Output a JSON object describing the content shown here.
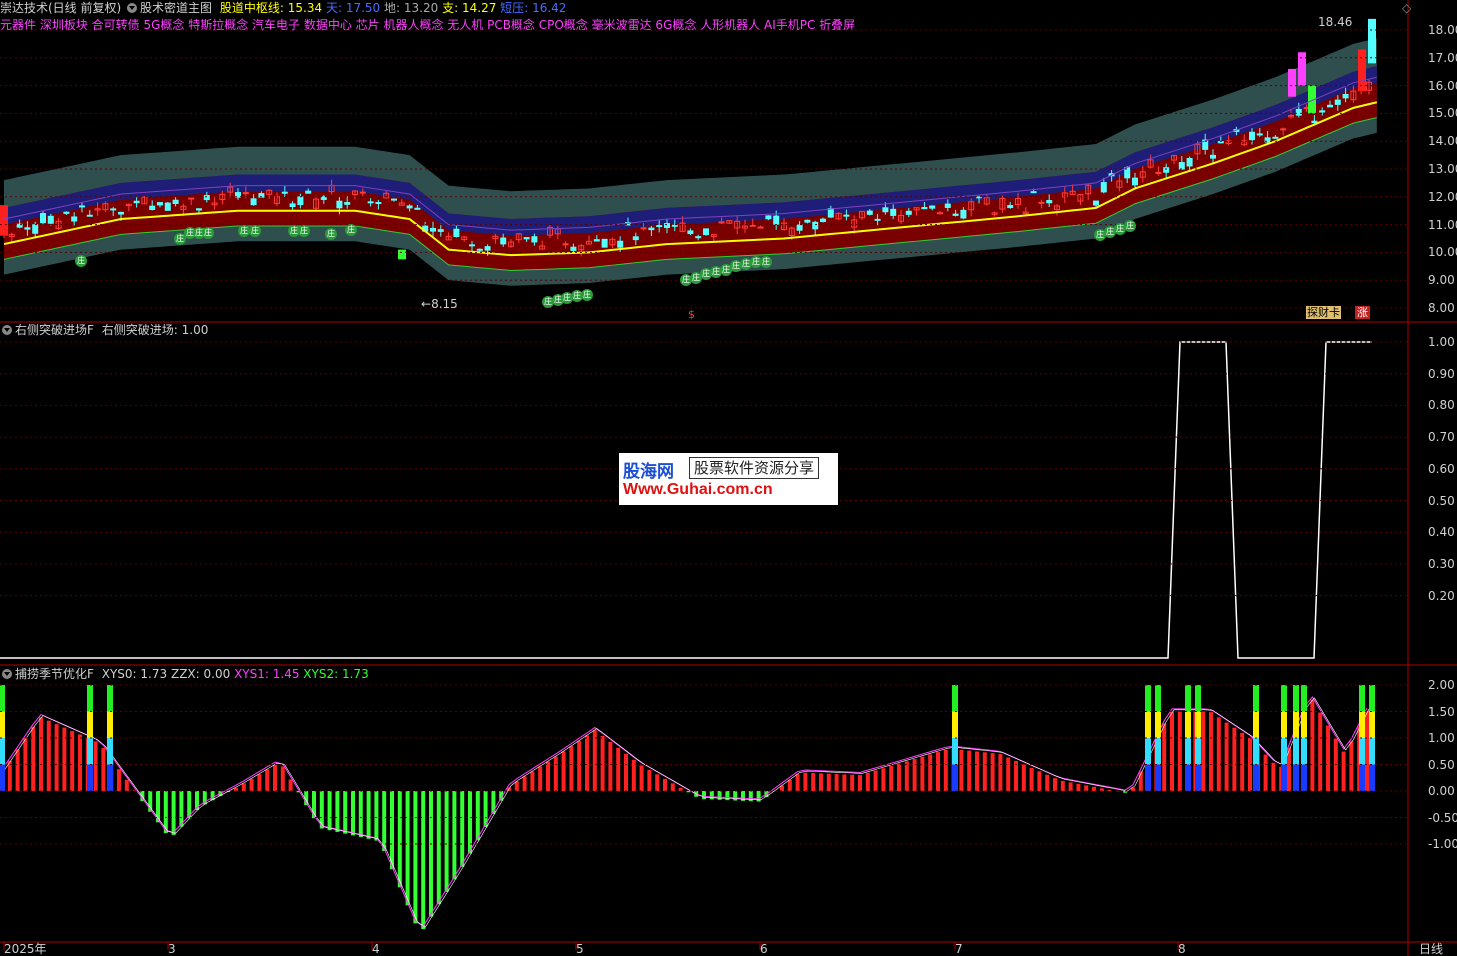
{
  "header": {
    "app_title": "崇达技术(日线 前复权)",
    "indicator_name": "股术密道主图",
    "center_label": "股道中枢线",
    "center_value": "15.34",
    "tian_label": "天",
    "tian_value": "17.50",
    "di_label": "地",
    "di_value": "13.20",
    "zhi_label": "支",
    "zhi_value": "14.27",
    "ya_label": "短压",
    "ya_value": "16.42"
  },
  "concepts_text": "元器件 深圳板块 合可转债 5G概念 特斯拉概念 汽车电子 数据中心 芯片 机器人概念 无人机 PCB概念 CPO概念 毫米波雷达 6G概念 人形机器人 AI手机PC 折叠屏",
  "main_chart": {
    "high_label": "18.46",
    "low_label": "8.15",
    "zhuang_label": "庄",
    "dollar_label": "$",
    "tag_buy": "探财卡",
    "tag_up": "涨",
    "y_ticks": [
      "18.00",
      "17.00",
      "16.00",
      "15.00",
      "14.00",
      "13.00",
      "12.00",
      "11.00",
      "10.00",
      "9.00",
      "8.00"
    ]
  },
  "panel2": {
    "name": "右侧突破进场F",
    "value_label": "右侧突破进场",
    "value": "1.00",
    "y_ticks": [
      "1.00",
      "0.90",
      "0.80",
      "0.70",
      "0.60",
      "0.50",
      "0.40",
      "0.30",
      "0.20"
    ]
  },
  "panel3": {
    "name": "捕捞季节优化F",
    "v1_label": "XYS0",
    "v1": "1.73",
    "v2_label": "ZZX",
    "v2": "0.00",
    "v3_label": "XYS1",
    "v3": "1.45",
    "v4_label": "XYS2",
    "v4": "1.73",
    "y_ticks": [
      "2.00",
      "1.50",
      "1.00",
      "0.50",
      "0.00",
      "-0.50",
      "-1.00"
    ]
  },
  "x_axis": {
    "labels": [
      "2025年",
      "3",
      "4",
      "5",
      "6",
      "7",
      "8"
    ],
    "period": "日线"
  },
  "watermark": {
    "brand": "股海网",
    "slogan": "股票软件资源分享",
    "url": "Www.Guhai.com.cn"
  },
  "colors": {
    "up": "#ff3b3b",
    "down": "#54ffff",
    "band_outer": "#2f4f4f",
    "band_mid": "#7a0000",
    "band_inner": "#1e1e78",
    "center_line": "#ffff00",
    "magenta": "#ff40ff",
    "green": "#33ff33"
  }
}
